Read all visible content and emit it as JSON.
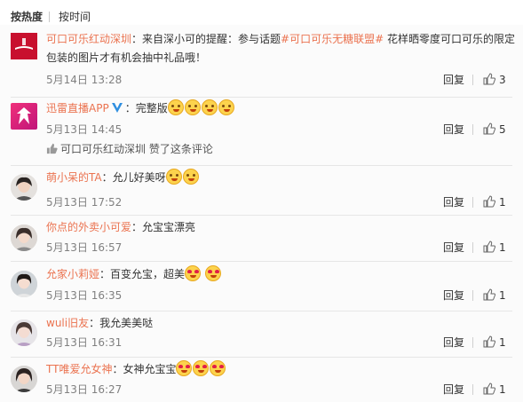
{
  "sort_tabs": {
    "hot": "按热度",
    "time": "按时间"
  },
  "colors": {
    "username": "#eb7350",
    "tag": "#eb7350",
    "time": "#808080",
    "background": "#fbfbfb"
  },
  "comments": [
    {
      "user": "可口可乐红动深圳",
      "sep": "：",
      "text_before": "来自深小可的提醒：参与话题",
      "tag": "#可口可乐无糖联盟#",
      "text_after": " 花样晒零度可口可乐的限定包装的图片才有机会抽中礼品哦！",
      "time": "5月14日 13:28",
      "reply": "回复",
      "likes": "3",
      "avatar_icon": "coca-cola-logo"
    },
    {
      "user": "迅雷直播APP",
      "sep": "：",
      "text": "完整版",
      "emoji_icon": "kissing-face-icon",
      "time": "5月13日 14:45",
      "reply": "回复",
      "likes": "5",
      "verified_icon": "verified-v-icon",
      "liked_by": "可口可乐红动深圳",
      "liked_suffix": " 赞了这条评论",
      "avatar_icon": "xunlei-logo"
    },
    {
      "user": "萌小呆的TA",
      "sep": "：",
      "text": "允儿好美呀",
      "time": "5月13日 17:52",
      "reply": "回复",
      "likes": "1",
      "emoji_icon": "kissing-face-icon"
    },
    {
      "user": "你点的外卖小可爱",
      "sep": "：",
      "text": "允宝宝漂亮",
      "time": "5月13日 16:57",
      "reply": "回复",
      "likes": "1"
    },
    {
      "user": "允家小莉娅",
      "sep": "：",
      "text": "百变允宝，超美",
      "time": "5月13日 16:35",
      "reply": "回复",
      "likes": "1",
      "emoji_icon": "heart-eyes-icon"
    },
    {
      "user": "wuli旧友",
      "sep": "：",
      "text": "我允美美哒",
      "time": "5月13日 16:31",
      "reply": "回复",
      "likes": "1"
    },
    {
      "user": "TT唯爱允女神",
      "sep": "：",
      "text": "女神允宝宝",
      "time": "5月13日 16:27",
      "reply": "回复",
      "likes": "1",
      "emoji_icon": "heart-eyes-icon"
    }
  ]
}
